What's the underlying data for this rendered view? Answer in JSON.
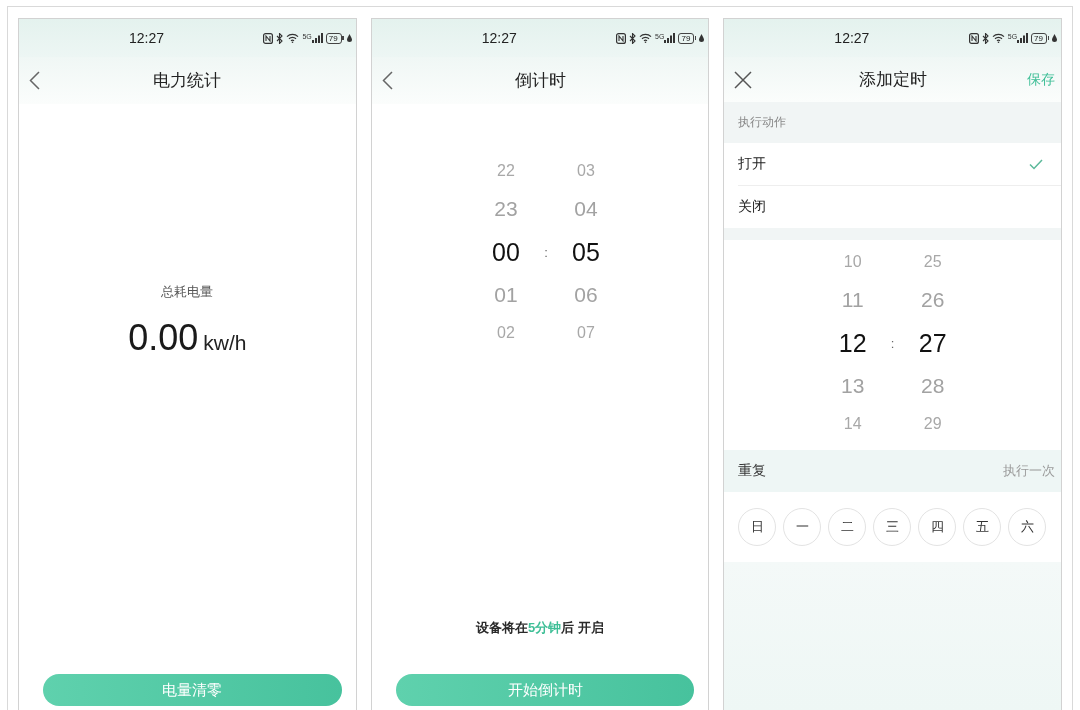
{
  "screens": [
    {
      "kind": "power_stats",
      "status_bar": {
        "time": "12:27",
        "network": "5G",
        "battery": "79"
      },
      "nav": {
        "leading": {
          "kind": "back"
        },
        "title": "电力统计"
      },
      "total": {
        "label": "总耗电量",
        "value": "0.00",
        "unit": "kw/h"
      },
      "button": "电量清零"
    },
    {
      "kind": "countdown",
      "status_bar": {
        "time": "12:27",
        "network": "5G",
        "battery": "79"
      },
      "nav": {
        "leading": {
          "kind": "back"
        },
        "title": "倒计时"
      },
      "picker": {
        "separator": ":",
        "columns": [
          {
            "items": [
              {
                "text": "22",
                "selected": false
              },
              {
                "text": "23",
                "selected": false
              },
              {
                "text": "00",
                "selected": true
              },
              {
                "text": "01",
                "selected": false
              },
              {
                "text": "02",
                "selected": false
              }
            ]
          },
          {
            "items": [
              {
                "text": "03",
                "selected": false
              },
              {
                "text": "04",
                "selected": false
              },
              {
                "text": "05",
                "selected": true
              },
              {
                "text": "06",
                "selected": false
              },
              {
                "text": "07",
                "selected": false
              }
            ]
          }
        ]
      },
      "message": [
        {
          "text": "设备将在",
          "highlight": false
        },
        {
          "text": "5分钟",
          "highlight": true
        },
        {
          "text": "后 开启",
          "highlight": false
        }
      ],
      "button": "开始倒计时"
    },
    {
      "kind": "add_timer",
      "status_bar": {
        "time": "12:27",
        "network": "5G",
        "battery": "79"
      },
      "nav": {
        "leading": {
          "kind": "close"
        },
        "title": "添加定时",
        "action": "保存"
      },
      "action_section": {
        "title": "执行动作",
        "options": [
          {
            "label": "打开",
            "selected": true
          },
          {
            "label": "关闭",
            "selected": false
          }
        ]
      },
      "picker": {
        "separator": ":",
        "columns": [
          {
            "items": [
              {
                "text": "10",
                "selected": false
              },
              {
                "text": "11",
                "selected": false
              },
              {
                "text": "12",
                "selected": true
              },
              {
                "text": "13",
                "selected": false
              },
              {
                "text": "14",
                "selected": false
              }
            ]
          },
          {
            "items": [
              {
                "text": "25",
                "selected": false
              },
              {
                "text": "26",
                "selected": false
              },
              {
                "text": "27",
                "selected": true
              },
              {
                "text": "28",
                "selected": false
              },
              {
                "text": "29",
                "selected": false
              }
            ]
          }
        ]
      },
      "repeat": {
        "label": "重复",
        "value": "执行一次"
      },
      "weekdays": [
        {
          "label": "日",
          "selected": false
        },
        {
          "label": "一",
          "selected": false
        },
        {
          "label": "二",
          "selected": false
        },
        {
          "label": "三",
          "selected": false
        },
        {
          "label": "四",
          "selected": false
        },
        {
          "label": "五",
          "selected": false
        },
        {
          "label": "六",
          "selected": false
        }
      ]
    }
  ]
}
